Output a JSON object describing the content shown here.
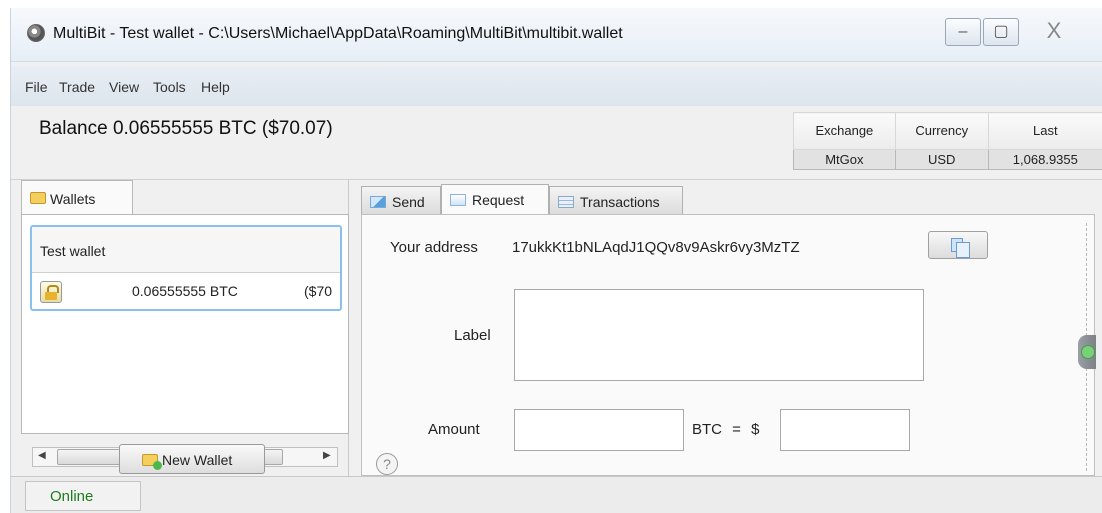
{
  "window": {
    "title": "MultiBit - Test wallet - C:\\Users\\Michael\\AppData\\Roaming\\MultiBit\\multibit.wallet",
    "close_glyph": "X"
  },
  "menu": [
    "File",
    "Trade",
    "View",
    "Tools",
    "Help"
  ],
  "balance": {
    "text": "Balance 0.06555555 BTC  ($70.07)"
  },
  "ticker": {
    "headers": [
      "Exchange",
      "Currency",
      "Last"
    ],
    "row": [
      "MtGox",
      "USD",
      "1,068.9355"
    ]
  },
  "wallets_panel": {
    "tab_label": "Wallets",
    "wallet": {
      "name": "Test wallet",
      "balance_btc": "0.06555555 BTC",
      "balance_fiat": "($70"
    },
    "scroll_thumb": "III",
    "new_wallet_label": "New Wallet"
  },
  "tabs": [
    "Send",
    "Request",
    "Transactions"
  ],
  "request": {
    "address_label": "Your address",
    "address_value": "17ukkKt1bNLAqdJ1QQv8v9Askr6vy3MzTZ",
    "label_label": "Label",
    "amount_label": "Amount",
    "btc_equals": "BTC  =  $",
    "help_glyph": "?"
  },
  "status": {
    "online": "Online"
  },
  "colors": {
    "online_green": "#1e7d1e",
    "wallet_selection_border": "#8ac0ee"
  }
}
